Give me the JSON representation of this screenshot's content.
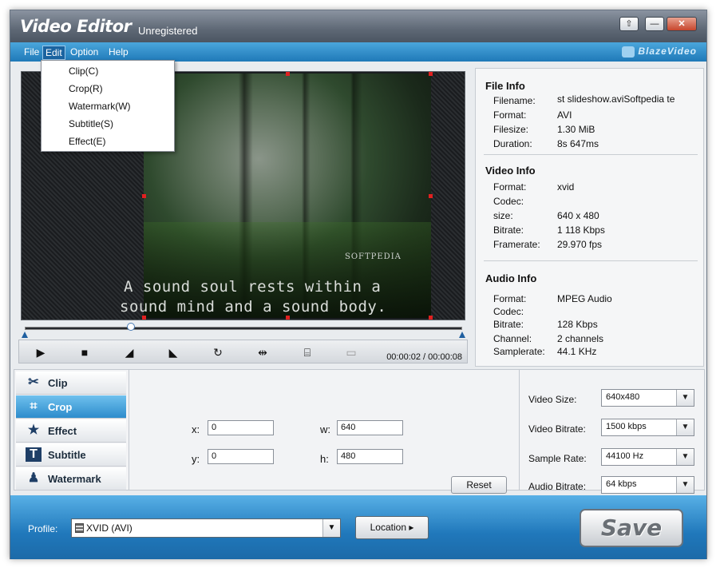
{
  "window": {
    "title": "Video Editor",
    "subtitle": "Unregistered",
    "brand": "BlazeVideo"
  },
  "titlebar_buttons": {
    "restore": "⇧",
    "minimize": "—",
    "close": "✕"
  },
  "menu": {
    "items": [
      "File",
      "Edit",
      "Option",
      "Help"
    ],
    "active": "Edit"
  },
  "edit_menu": [
    "Clip(C)",
    "Crop(R)",
    "Watermark(W)",
    "Subtitle(S)",
    "Effect(E)"
  ],
  "preview": {
    "watermark": "SOFTPEDIA",
    "subtitle_lines": [
      "A sound soul rests within a",
      "sound mind and a sound body."
    ],
    "progress": 0.25
  },
  "controls": {
    "play": "▶",
    "stop": "■",
    "mark_in": "◢",
    "mark_out": "◣",
    "rotate": "↻",
    "flip": "⇹",
    "snapshot": "⌸",
    "fullscreen": "▭",
    "time": "00:00:02 / 00:00:08"
  },
  "file_info": {
    "heading": "File Info",
    "rows": [
      {
        "k": "Filename:",
        "v": "st slideshow.aviSoftpedia te"
      },
      {
        "k": "Format:",
        "v": "AVI"
      },
      {
        "k": "Filesize:",
        "v": "1.30 MiB"
      },
      {
        "k": "Duration:",
        "v": "8s 647ms"
      }
    ]
  },
  "video_info": {
    "heading": "Video Info",
    "rows": [
      {
        "k": "Format:",
        "v": "xvid"
      },
      {
        "k": "Codec:",
        "v": ""
      },
      {
        "k": "size:",
        "v": "640 x 480"
      },
      {
        "k": "Bitrate:",
        "v": "1 118 Kbps"
      },
      {
        "k": "Framerate:",
        "v": "29.970 fps"
      }
    ]
  },
  "audio_info": {
    "heading": "Audio Info",
    "rows": [
      {
        "k": "Format:",
        "v": "MPEG Audio"
      },
      {
        "k": "Codec:",
        "v": ""
      },
      {
        "k": "Bitrate:",
        "v": "128 Kbps"
      },
      {
        "k": "Channel:",
        "v": "2 channels"
      },
      {
        "k": "Samplerate:",
        "v": "44.1 KHz"
      }
    ]
  },
  "tabs": [
    {
      "label": "Clip",
      "icon": "scissors-icon",
      "glyph": "✂"
    },
    {
      "label": "Crop",
      "icon": "crop-icon",
      "glyph": "⌗"
    },
    {
      "label": "Effect",
      "icon": "star-icon",
      "glyph": "★"
    },
    {
      "label": "Subtitle",
      "icon": "film-text-icon",
      "glyph": "T"
    },
    {
      "label": "Watermark",
      "icon": "person-icon",
      "glyph": "♟"
    }
  ],
  "active_tab": "Crop",
  "crop": {
    "x_label": "x:",
    "x": "0",
    "y_label": "y:",
    "y": "0",
    "w_label": "w:",
    "w": "640",
    "h_label": "h:",
    "h": "480",
    "reset": "Reset"
  },
  "output": {
    "video_size_label": "Video Size:",
    "video_size": "640x480",
    "video_bitrate_label": "Video Bitrate:",
    "video_bitrate": "1500 kbps",
    "sample_rate_label": "Sample Rate:",
    "sample_rate": "44100 Hz",
    "audio_bitrate_label": "Audio Bitrate:",
    "audio_bitrate": "64 kbps"
  },
  "bottom": {
    "profile_label": "Profile:",
    "profile_value": "XVID (AVI)",
    "location": "Location ▸",
    "save": "Save"
  },
  "colors": {
    "accent": "#2d8ccc",
    "menubar": "#1f79b8",
    "titlebar": "#5e6875"
  }
}
